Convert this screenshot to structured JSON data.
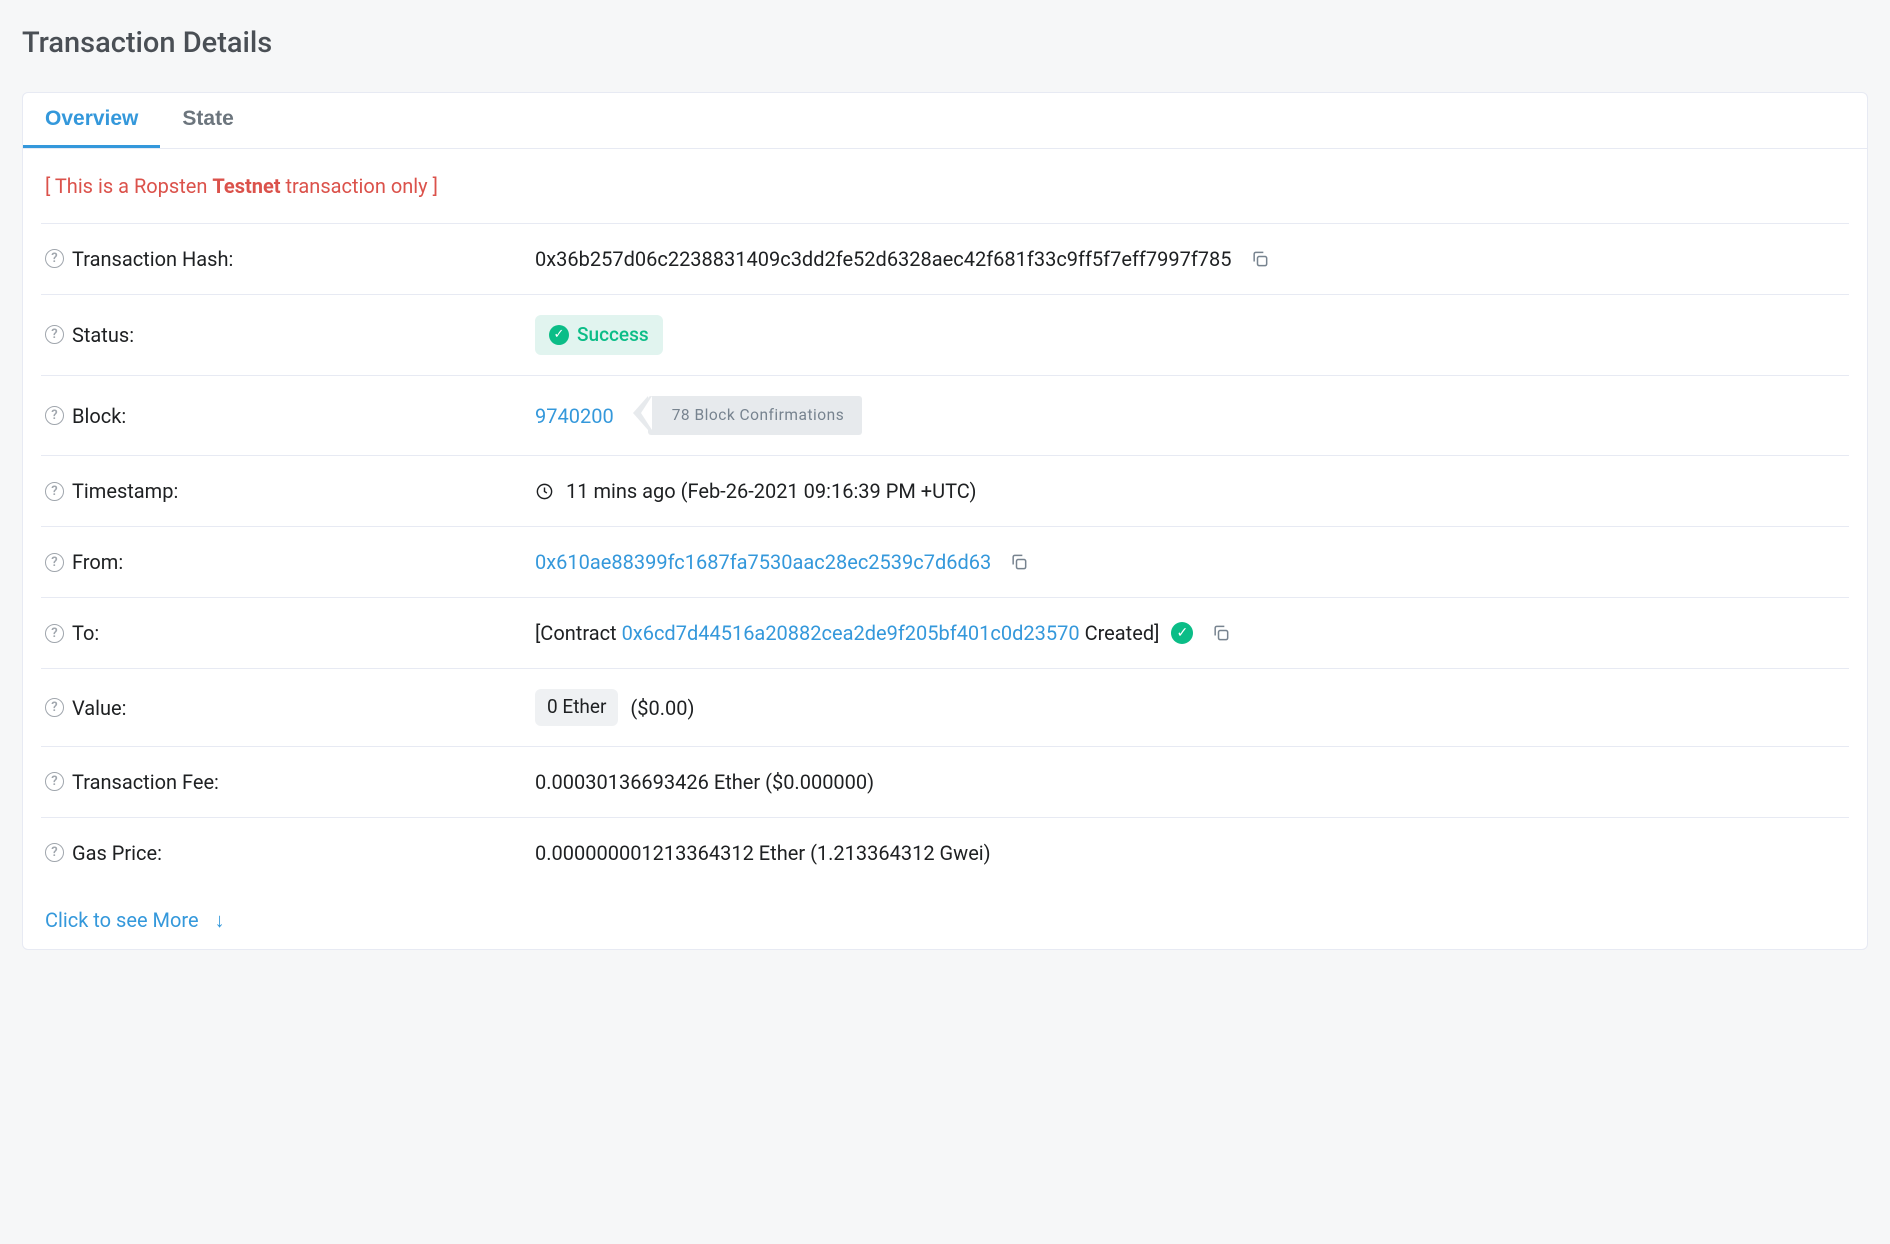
{
  "page_title": "Transaction Details",
  "tabs": {
    "overview": "Overview",
    "state": "State"
  },
  "testnet_notice": {
    "prefix": "[ This is a Ropsten ",
    "bold": "Testnet",
    "suffix": " transaction only ]"
  },
  "labels": {
    "tx_hash": "Transaction Hash:",
    "status": "Status:",
    "block": "Block:",
    "timestamp": "Timestamp:",
    "from": "From:",
    "to": "To:",
    "value": "Value:",
    "tx_fee": "Transaction Fee:",
    "gas_price": "Gas Price:"
  },
  "values": {
    "tx_hash": "0x36b257d06c2238831409c3dd2fe52d6328aec42f681f33c9ff5f7eff7997f785",
    "status": "Success",
    "block_number": "9740200",
    "block_confirmations": "78 Block Confirmations",
    "timestamp": "11 mins ago (Feb-26-2021 09:16:39 PM +UTC)",
    "from": "0x610ae88399fc1687fa7530aac28ec2539c7d6d63",
    "to_prefix": "[Contract ",
    "to_address": "0x6cd7d44516a20882cea2de9f205bf401c0d23570",
    "to_suffix": " Created]",
    "value_badge": "0 Ether",
    "value_usd": "($0.00)",
    "tx_fee": "0.00030136693426 Ether ($0.000000)",
    "gas_price": "0.000000001213364312 Ether (1.213364312 Gwei)"
  },
  "see_more": "Click to see More"
}
